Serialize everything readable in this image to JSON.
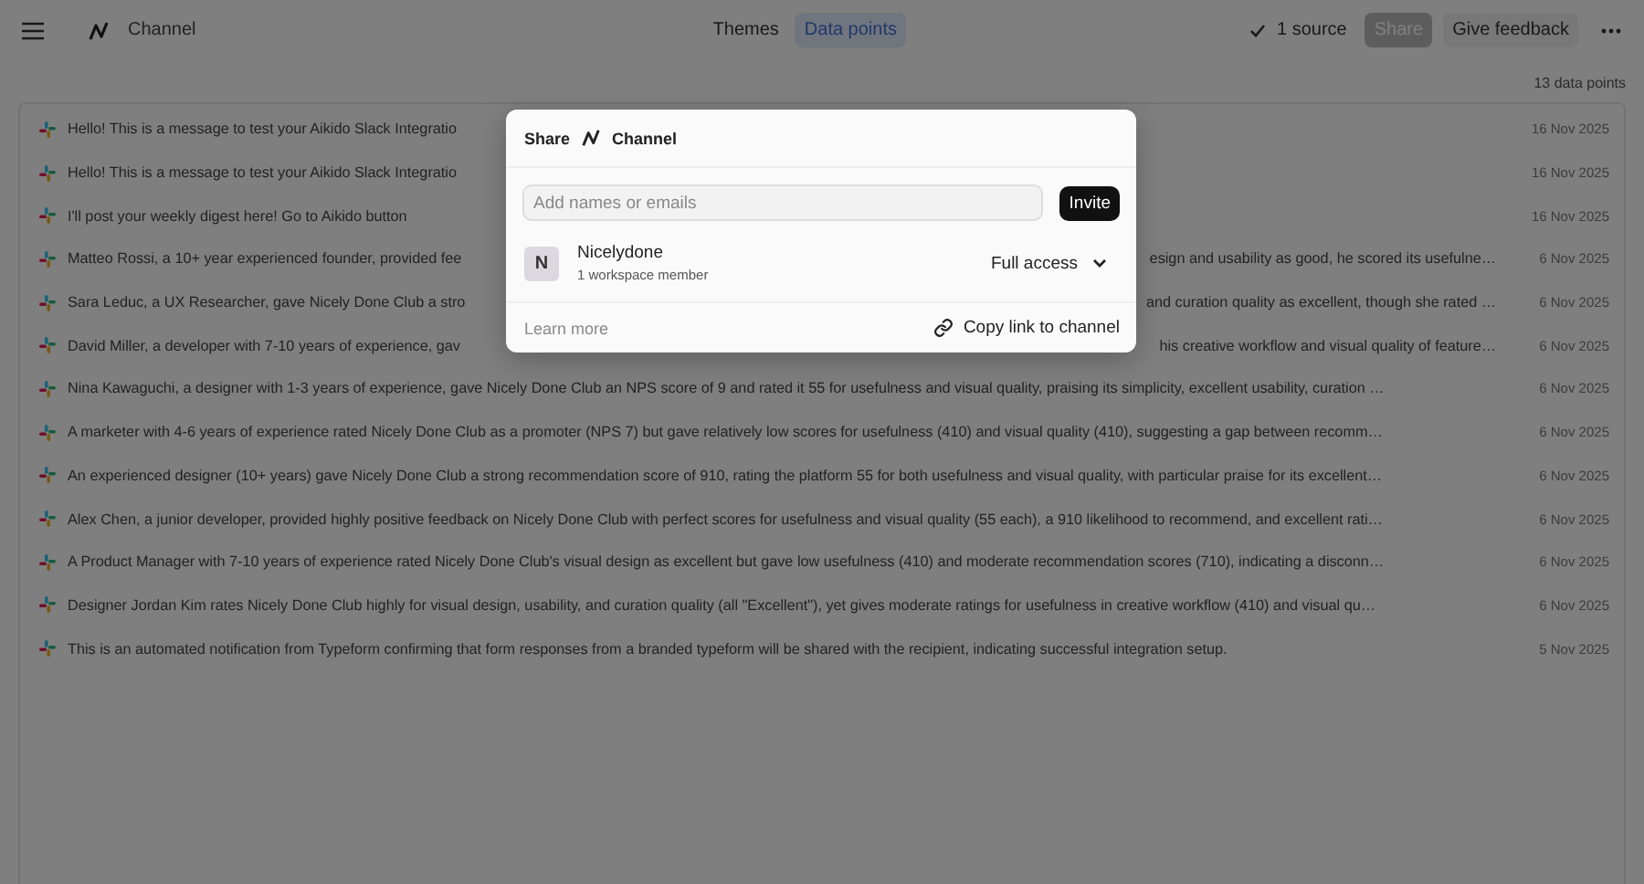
{
  "top_bar": {
    "title": "Channel",
    "tabs": [
      {
        "label": "Themes",
        "selected": false
      },
      {
        "label": "Data points",
        "selected": true
      }
    ],
    "source_label": "1 source",
    "buttons": [
      {
        "label": "Share",
        "kind": "primary"
      },
      {
        "label": "Give feedback",
        "kind": "secondary"
      }
    ]
  },
  "count": "13 data points",
  "rows": [
    {
      "text": "Hello! This is a message to test your Aikido Slack Integratio",
      "date": "16 Nov 2025"
    },
    {
      "text": "Hello! This is a message to test your Aikido Slack Integratio",
      "date": "16 Nov 2025"
    },
    {
      "text": "I'll post your weekly digest here! Go to Aikido button",
      "date": "16 Nov 2025"
    },
    {
      "text": "Matteo Rossi, a 10+ year experienced founder, provided fee",
      "text_after": "esign and usability as good, he scored its usefulne…",
      "date": "6 Nov 2025"
    },
    {
      "text": "Sara Leduc, a UX Researcher, gave Nicely Done Club a stro",
      "text_after": "and curation quality as excellent, though she rated …",
      "date": "6 Nov 2025"
    },
    {
      "text": "David Miller, a developer with 7-10 years of experience, gav",
      "text_after": "his creative workflow and visual quality of feature…",
      "date": "6 Nov 2025"
    },
    {
      "text": "Nina Kawaguchi, a designer with 1-3 years of experience, gave Nicely Done Club an NPS score of 9 and rated it 55 for usefulness and visual quality, praising its simplicity, excellent usability, curation …",
      "date": "6 Nov 2025"
    },
    {
      "text": "A marketer with 4-6 years of experience rated Nicely Done Club as a promoter (NPS 7) but gave relatively low scores for usefulness (410) and visual quality (410), suggesting a gap between recomm…",
      "date": "6 Nov 2025"
    },
    {
      "text": "An experienced designer (10+ years) gave Nicely Done Club a strong recommendation score of 910, rating the platform 55 for both usefulness and visual quality, with particular praise for its excellent…",
      "date": "6 Nov 2025"
    },
    {
      "text": "Alex Chen, a junior developer, provided highly positive feedback on Nicely Done Club with perfect scores for usefulness and visual quality (55 each), a 910 likelihood to recommend, and excellent rati…",
      "date": "6 Nov 2025"
    },
    {
      "text": "A Product Manager with 7-10 years of experience rated Nicely Done Club's visual design as excellent but gave low usefulness (410) and moderate recommendation scores (710), indicating a disconn…",
      "date": "6 Nov 2025"
    },
    {
      "text": "Designer Jordan Kim rates Nicely Done Club highly for visual design, usability, and curation quality (all \"Excellent\"), yet gives moderate ratings for usefulness in creative workflow (410) and visual qu…",
      "date": "6 Nov 2025"
    },
    {
      "text": "This is an automated notification from Typeform confirming that form responses from a branded typeform will be shared with the recipient, indicating successful integration setup.",
      "date": "5 Nov 2025"
    }
  ],
  "dialog": {
    "title": "Share",
    "channel": "Channel",
    "placeholder": "Add names or emails",
    "invite": "Invite",
    "member": {
      "initial": "N",
      "name": "Nicelydone",
      "subtitle": "1 workspace member",
      "access": "Full access"
    },
    "learn_more": "Learn more",
    "copy_link": "Copy link to channel"
  }
}
